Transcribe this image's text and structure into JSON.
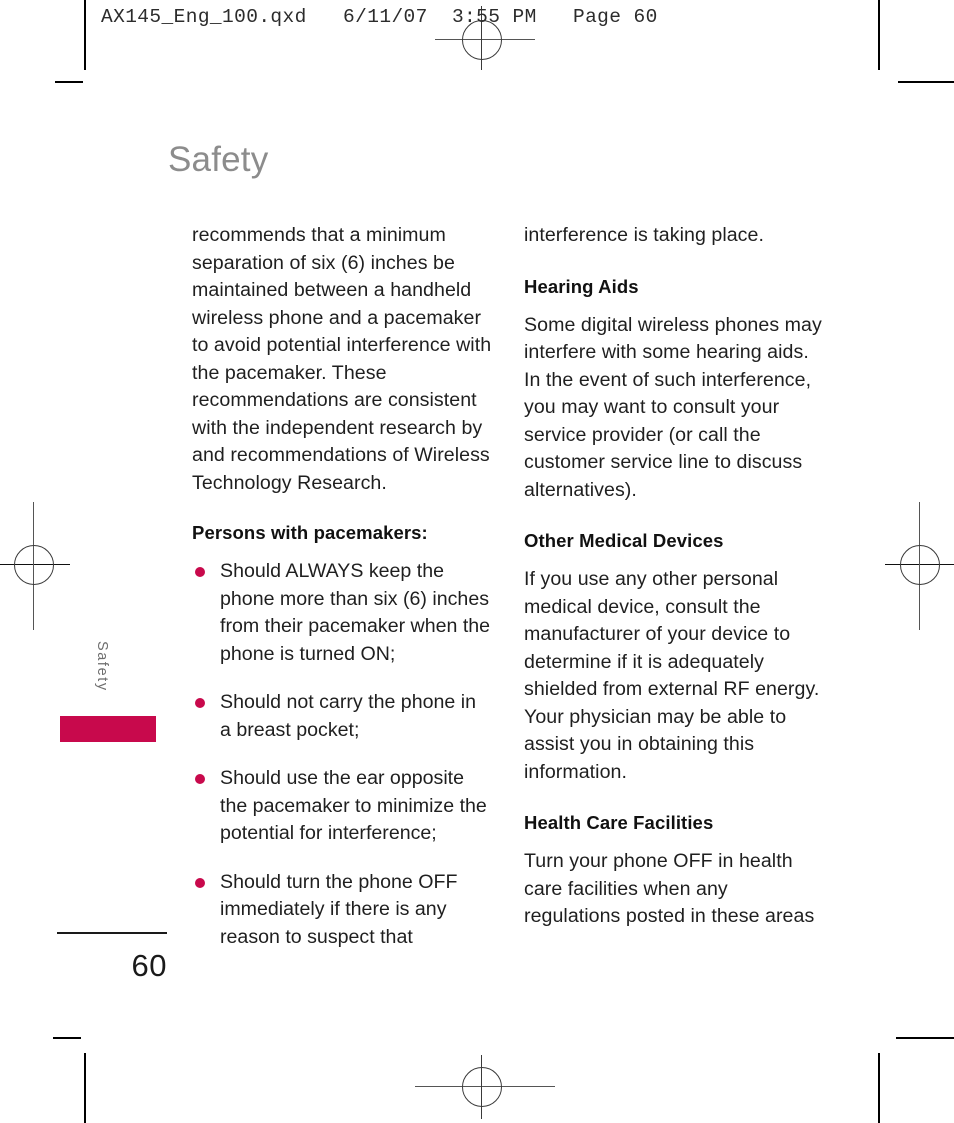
{
  "colors": {
    "accent": "#c8094c",
    "title_gray": "#8c8c8c",
    "body_text": "#1f1f1f"
  },
  "print_header": {
    "text": "AX145_Eng_100.qxd   6/11/07  3:55 PM   Page 60"
  },
  "page": {
    "title": "Safety",
    "side_tab_label": "Safety",
    "folio": "60"
  },
  "left_column": {
    "continued_paragraph": "recommends that a minimum separation of six (6) inches be maintained between a handheld wireless phone and a pacemaker to avoid potential interference with the pacemaker. These recommendations are consistent with the independent research by and recommendations of Wireless Technology Research.",
    "list_heading": "Persons with pacemakers:",
    "bullets": [
      "Should ALWAYS keep the phone more than six (6) inches from their pacemaker when the phone is turned ON;",
      "Should not carry the phone in a breast pocket;",
      "Should use the ear opposite the pacemaker to minimize the potential for interference;",
      "Should turn the phone OFF immediately if there is any reason to suspect that"
    ]
  },
  "right_column": {
    "continued_paragraph": "interference is taking place.",
    "sections": [
      {
        "heading": "Hearing Aids",
        "body": "Some digital wireless phones may interfere with some hearing aids. In the event of such interference, you may want to consult your service provider (or call the customer service line to discuss alternatives)."
      },
      {
        "heading": "Other Medical Devices",
        "body": "If you use any other personal medical device, consult the manufacturer of your device to determine if it is adequately shielded from external RF energy. Your physician may be able to assist you in obtaining this information."
      },
      {
        "heading": "Health Care Facilities",
        "body": "Turn your phone OFF in health care facilities when any regulations posted in these areas"
      }
    ]
  }
}
